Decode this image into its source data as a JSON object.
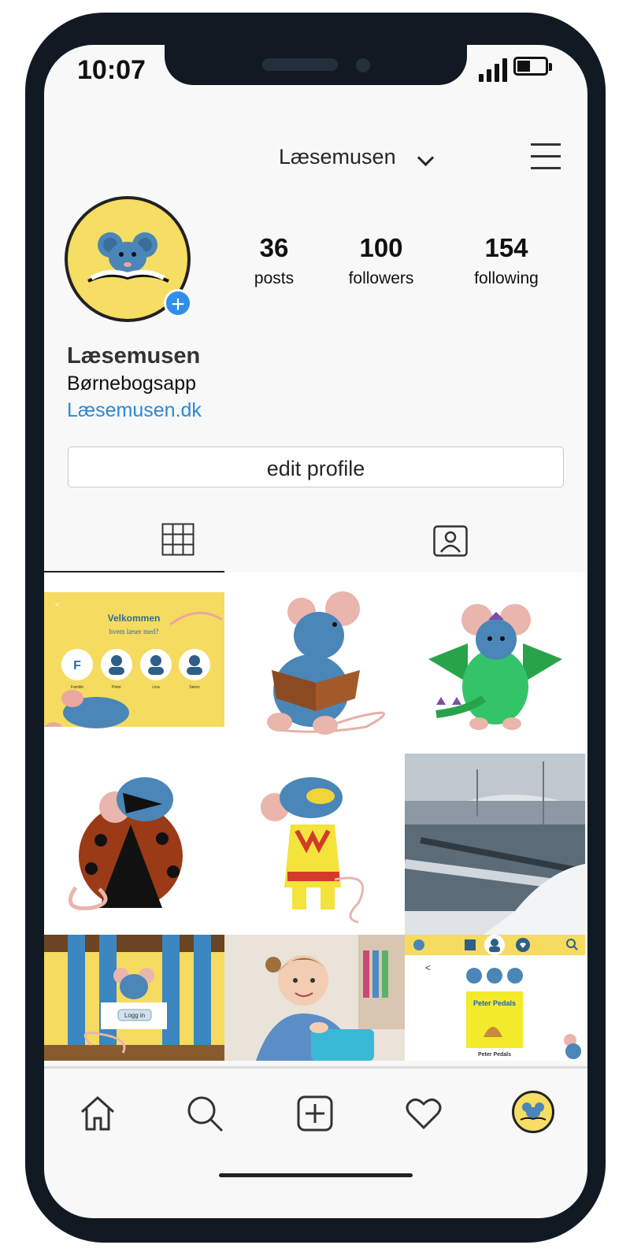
{
  "status_bar": {
    "time": "10:07"
  },
  "header": {
    "username": "Læsemusen"
  },
  "profile": {
    "stats": [
      {
        "value": "36",
        "label": "posts"
      },
      {
        "value": "100",
        "label": "followers"
      },
      {
        "value": "154",
        "label": "following"
      }
    ],
    "name": "Læsemusen",
    "bio": "Børnebogsapp",
    "link": "Læsemusen.dk",
    "edit_label": "edit profile"
  },
  "posts": {
    "welcome": {
      "title": "Velkommen",
      "subtitle": "hvem læser med?",
      "initial": "F",
      "names": [
        "Familie",
        "Peter",
        "Lina",
        "Søren"
      ]
    },
    "login": {
      "button": "Logg in"
    },
    "app": {
      "back": "<",
      "book_title": "Peter Pedals",
      "book_caption": "Peter Pedals"
    }
  },
  "colors": {
    "accent": "#2f8fea",
    "brand_yellow": "#f6dd63",
    "mouse_blue": "#4a86b8"
  }
}
